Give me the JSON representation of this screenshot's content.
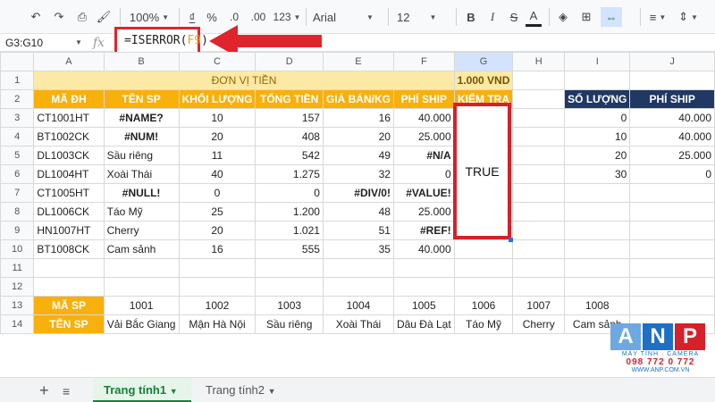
{
  "toolbar": {
    "zoom": "100%",
    "currency": "₫",
    "percent": "%",
    "dec_less": ".0",
    "dec_more": ".00",
    "more_formats": "123",
    "font": "Arial",
    "font_size": "12",
    "bold": "B",
    "italic": "I",
    "text_color": "A"
  },
  "formula_bar": {
    "name_box": "G3:G10",
    "fx": "fx",
    "formula_prefix": "=ISERROR(",
    "formula_ref": "F9",
    "formula_suffix": ")"
  },
  "columns": [
    "A",
    "B",
    "C",
    "D",
    "E",
    "F",
    "G",
    "H",
    "I",
    "J"
  ],
  "rows": [
    "1",
    "2",
    "3",
    "4",
    "5",
    "6",
    "7",
    "8",
    "9",
    "10",
    "11",
    "12",
    "13",
    "14"
  ],
  "header_row1": {
    "label": "ĐƠN VỊ TIỀN",
    "unit": "1.000 VND"
  },
  "table_headers": [
    "MÃ ĐH",
    "TÊN SP",
    "KHỐI LƯỢNG",
    "TỔNG TIỀN",
    "GIÁ BÁN/KG",
    "PHÍ SHIP",
    "KIỂM TRA"
  ],
  "orders": [
    [
      "CT1001HT",
      "#NAME?",
      "10",
      "157",
      "16",
      "40.000"
    ],
    [
      "BT1002CK",
      "#NUM!",
      "20",
      "408",
      "20",
      "25.000"
    ],
    [
      "DL1003CK",
      "Sầu riêng",
      "11",
      "542",
      "49",
      "#N/A"
    ],
    [
      "DL1004HT",
      "Xoài Thái",
      "40",
      "1.275",
      "32",
      "0"
    ],
    [
      "CT1005HT",
      "#NULL!",
      "0",
      "0",
      "#DIV/0!",
      "#VALUE!"
    ],
    [
      "DL1006CK",
      "Táo Mỹ",
      "25",
      "1.200",
      "48",
      "25.000"
    ],
    [
      "HN1007HT",
      "Cherry",
      "20",
      "1.021",
      "51",
      "#REF!"
    ],
    [
      "BT1008CK",
      "Cam sảnh",
      "16",
      "555",
      "35",
      "40.000"
    ]
  ],
  "result": "TRUE",
  "ship_table": {
    "headers": [
      "SỐ LƯỢNG",
      "PHÍ SHIP"
    ],
    "rows": [
      [
        "0",
        "40.000"
      ],
      [
        "10",
        "40.000"
      ],
      [
        "20",
        "25.000"
      ],
      [
        "30",
        "0"
      ]
    ]
  },
  "products": {
    "code_label": "MÃ SP",
    "name_label": "TÊN SP",
    "codes": [
      "1001",
      "1002",
      "1003",
      "1004",
      "1005",
      "1006",
      "1007",
      "1008"
    ],
    "names": [
      "Vải Bắc Giang",
      "Mận Hà Nội",
      "Sầu riêng",
      "Xoài Thái",
      "Dâu Đà Lạt",
      "Táo Mỹ",
      "Cherry",
      "Cam sảnh"
    ]
  },
  "tabs": [
    "Trang tính1",
    "Trang tính2"
  ],
  "logo": {
    "letters": [
      "A",
      "N",
      "P"
    ],
    "tagline": "MÁY TÍNH · CAMERA",
    "phone": "098 772 0 772",
    "web": "WWW.ANP.COM.VN"
  },
  "colors": {
    "accent": "#f9b00b",
    "navy": "#1f3864",
    "highlight": "#d6202a"
  }
}
